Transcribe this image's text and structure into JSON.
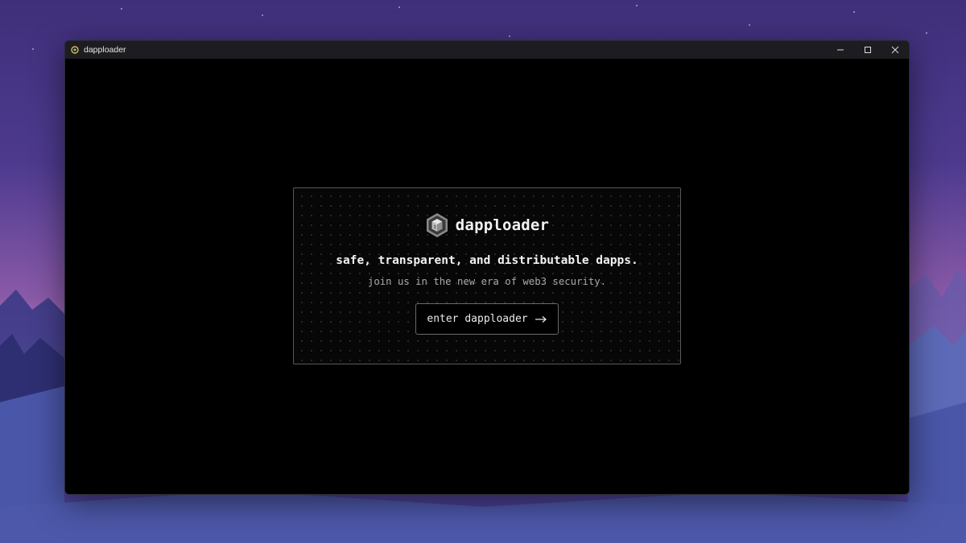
{
  "window": {
    "title": "dapploader",
    "controls": [
      "minimize",
      "maximize",
      "close"
    ]
  },
  "landing": {
    "brand_name": "dapploader",
    "headline": "safe, transparent, and distributable dapps.",
    "subline": "join us in the new era of web3 security.",
    "enter_button_label": "enter dapploader"
  },
  "icons": {
    "app_icon": "dapploader-app-icon",
    "logo": "dapploader-logo-icon",
    "enter_arrow": "arrow-right-icon"
  },
  "colors": {
    "window_background": "#000000",
    "titlebar": "#1d1c21",
    "card_border": "#5a5a5a",
    "headline": "#f2f2f2",
    "subline": "#a8a8a8"
  }
}
